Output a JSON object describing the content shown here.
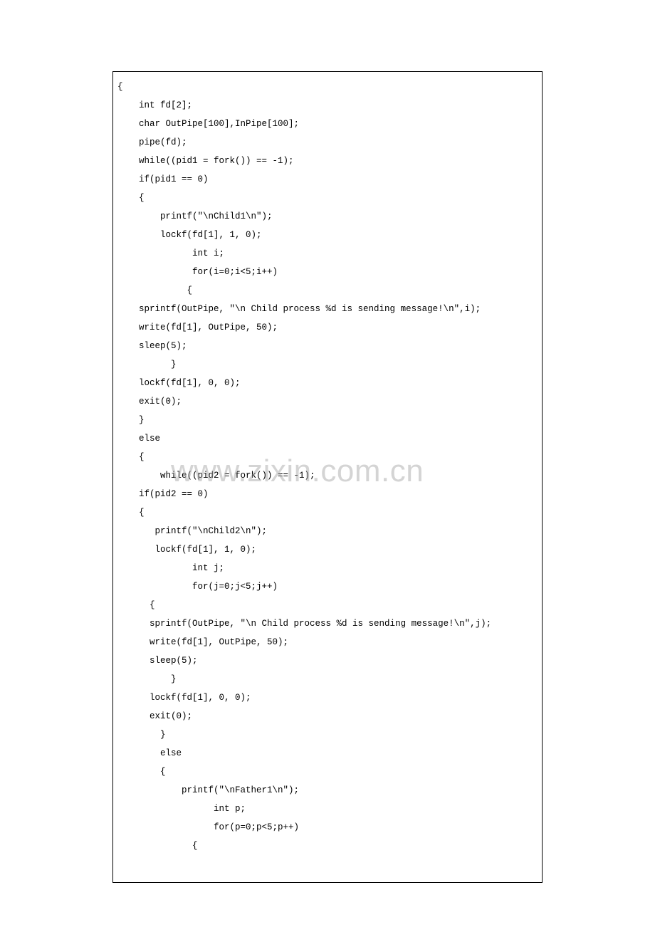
{
  "watermark": "www.zixin.com.cn",
  "code": {
    "lines": [
      "{",
      "    int fd[2];",
      "    char OutPipe[100],InPipe[100];",
      "    pipe(fd);",
      "",
      "    while((pid1 = fork()) == -1);",
      "    if(pid1 == 0)",
      "    {",
      "        printf(\"\\nChild1\\n\");",
      "        lockf(fd[1], 1, 0);",
      "              int i;",
      "              for(i=0;i<5;i++)",
      "             {",
      "    sprintf(OutPipe, \"\\n Child process %d is sending message!\\n\",i);",
      "",
      "    write(fd[1], OutPipe, 50);",
      "    sleep(5);",
      "          }",
      "    lockf(fd[1], 0, 0);",
      "    exit(0);",
      "    }",
      "    else",
      "    {",
      "        while((pid2 = fork()) == -1);",
      "    if(pid2 == 0)",
      "    {",
      "       printf(\"\\nChild2\\n\");",
      "       lockf(fd[1], 1, 0);",
      "              int j;",
      "              for(j=0;j<5;j++)",
      "      {",
      "      sprintf(OutPipe, \"\\n Child process %d is sending message!\\n\",j);",
      "      write(fd[1], OutPipe, 50);",
      "      sleep(5);",
      "          }",
      "      lockf(fd[1], 0, 0);",
      "      exit(0);",
      "        }",
      "        else",
      "        {",
      "            printf(\"\\nFather1\\n\");",
      "                  int p;",
      "                  for(p=0;p<5;p++)",
      "              {"
    ]
  }
}
